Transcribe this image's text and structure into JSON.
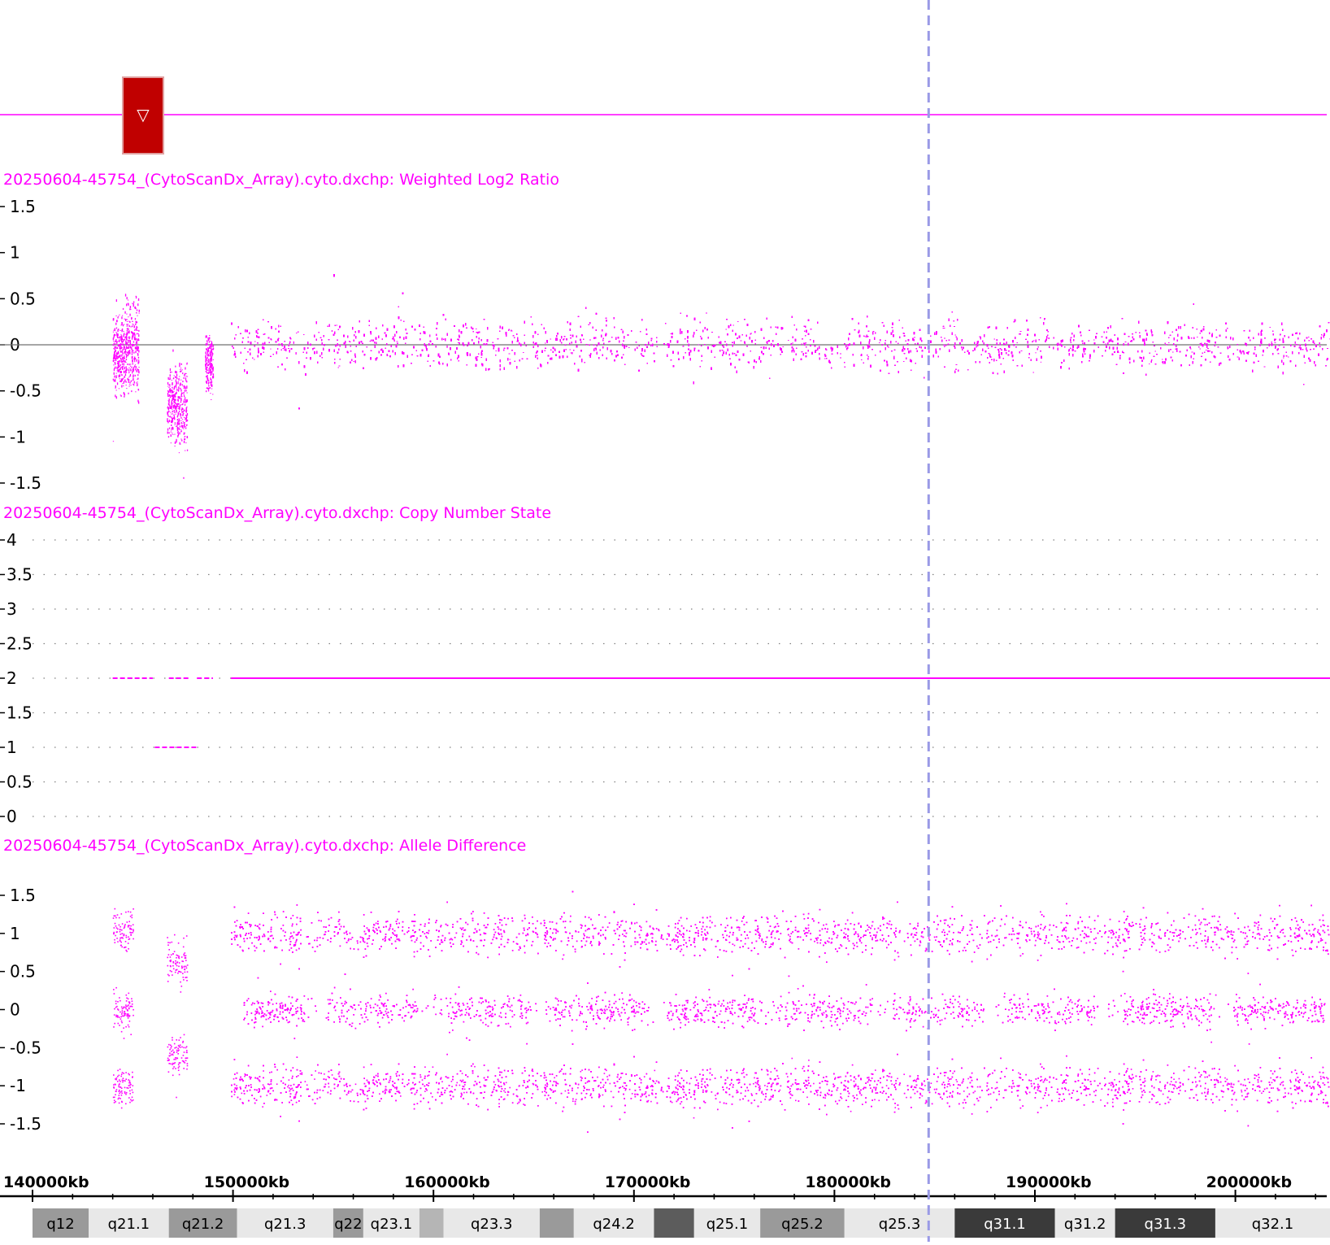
{
  "colors": {
    "data": "#ff00ff",
    "cursor": "#9a9ae6",
    "marker": "#c00000",
    "zero_line": "#707070",
    "grid": "#808080"
  },
  "marker": {
    "icon": "triangle-down-icon",
    "glyph": "▽"
  },
  "panels": {
    "log2": {
      "title": "20250604-45754_(CytoScanDx_Array).cyto.dxchp: Weighted Log2 Ratio"
    },
    "cn": {
      "title": "20250604-45754_(CytoScanDx_Array).cyto.dxchp: Copy Number State"
    },
    "ad": {
      "title": "20250604-45754_(CytoScanDx_Array).cyto.dxchp: Allele Difference"
    }
  },
  "chart_data": [
    {
      "type": "scatter",
      "title": "20250604-45754_(CytoScanDx_Array).cyto.dxchp: Weighted Log2 Ratio",
      "y_ticks": [
        "1.5",
        "1",
        "0.5",
        "0",
        "-0.5",
        "-1",
        "-1.5"
      ],
      "ylim": [
        -1.5,
        1.5
      ],
      "zero_line": true,
      "xlim_kb": [
        140000,
        206000
      ],
      "segments": [
        {
          "x_start": 144000,
          "x_end": 144600,
          "y_mean": -0.1,
          "spread": 0.2
        },
        {
          "x_start": 144600,
          "x_end": 145300,
          "y_mean": -0.05,
          "spread": 0.25
        },
        {
          "x_start": 146700,
          "x_end": 147700,
          "y_mean": -0.65,
          "spread": 0.2
        },
        {
          "x_start": 148600,
          "x_end": 149000,
          "y_mean": -0.2,
          "spread": 0.15
        },
        {
          "x_start": 149900,
          "x_end": 206000,
          "y_mean": 0.0,
          "spread": 0.13
        }
      ]
    },
    {
      "type": "line",
      "title": "20250604-45754_(CytoScanDx_Array).cyto.dxchp: Copy Number State",
      "y_ticks": [
        "4",
        "3.5",
        "3",
        "2.5",
        "2",
        "1.5",
        "1",
        "0.5",
        "0"
      ],
      "ylim": [
        0,
        4
      ],
      "grid": true,
      "xlim_kb": [
        140000,
        206000
      ],
      "segments": [
        {
          "x_start": 144000,
          "x_end": 146000,
          "value": 2
        },
        {
          "x_start": 146800,
          "x_end": 147800,
          "value": 2
        },
        {
          "x_start": 148200,
          "x_end": 149000,
          "value": 2
        },
        {
          "x_start": 146100,
          "x_end": 148200,
          "value": 1
        },
        {
          "x_start": 149900,
          "x_end": 206000,
          "value": 2
        }
      ]
    },
    {
      "type": "scatter",
      "title": "20250604-45754_(CytoScanDx_Array).cyto.dxchp: Allele Difference",
      "y_ticks": [
        "1.5",
        "1",
        "0.5",
        "0",
        "-0.5",
        "-1",
        "-1.5"
      ],
      "ylim": [
        -1.5,
        1.5
      ],
      "xlim_kb": [
        140000,
        206000
      ],
      "bands": [
        {
          "x_start": 149900,
          "x_end": 206000,
          "y": 1.0
        },
        {
          "x_start": 150500,
          "x_end": 206000,
          "y": 0.0
        },
        {
          "x_start": 149900,
          "x_end": 206000,
          "y": -1.0
        },
        {
          "x_start": 146700,
          "x_end": 147700,
          "y": 0.6
        },
        {
          "x_start": 146700,
          "x_end": 147700,
          "y": -0.6
        },
        {
          "x_start": 144000,
          "x_end": 145000,
          "y": 1.05
        },
        {
          "x_start": 144000,
          "x_end": 145000,
          "y": -1.0
        },
        {
          "x_start": 144000,
          "x_end": 145000,
          "y": 0.0
        }
      ]
    }
  ],
  "x_axis": {
    "ticks": [
      {
        "kb": 140000,
        "label": "140000kb"
      },
      {
        "kb": 150000,
        "label": "150000kb"
      },
      {
        "kb": 160000,
        "label": "160000kb"
      },
      {
        "kb": 170000,
        "label": "170000kb"
      },
      {
        "kb": 180000,
        "label": "180000kb"
      },
      {
        "kb": 190000,
        "label": "190000kb"
      },
      {
        "kb": 200000,
        "label": "200000kb"
      }
    ]
  },
  "cursor_kb": 184700,
  "cytobands": [
    {
      "label": "q12",
      "start": 140000,
      "end": 142800,
      "shade": "#9a9a9a"
    },
    {
      "label": "q21.1",
      "start": 142800,
      "end": 146800,
      "shade": "#e8e8e8"
    },
    {
      "label": "q21.2",
      "start": 146800,
      "end": 150200,
      "shade": "#9a9a9a"
    },
    {
      "label": "q21.3",
      "start": 150200,
      "end": 155000,
      "shade": "#e8e8e8"
    },
    {
      "label": "q22",
      "start": 155000,
      "end": 156500,
      "shade": "#9a9a9a"
    },
    {
      "label": "q23.1",
      "start": 156500,
      "end": 159300,
      "shade": "#e8e8e8"
    },
    {
      "label": "",
      "start": 159300,
      "end": 160500,
      "shade": "#b5b5b5"
    },
    {
      "label": "q23.3",
      "start": 160500,
      "end": 165300,
      "shade": "#e8e8e8"
    },
    {
      "label": "",
      "start": 165300,
      "end": 167000,
      "shade": "#9a9a9a"
    },
    {
      "label": "q24.2",
      "start": 167000,
      "end": 171000,
      "shade": "#e8e8e8"
    },
    {
      "label": "",
      "start": 171000,
      "end": 173000,
      "shade": "#5c5c5c"
    },
    {
      "label": "q25.1",
      "start": 173000,
      "end": 176300,
      "shade": "#e8e8e8"
    },
    {
      "label": "q25.2",
      "start": 176300,
      "end": 180500,
      "shade": "#9a9a9a"
    },
    {
      "label": "q25.3",
      "start": 180500,
      "end": 186000,
      "shade": "#e8e8e8"
    },
    {
      "label": "q31.1",
      "start": 186000,
      "end": 191000,
      "shade": "#3a3a3a"
    },
    {
      "label": "q31.2",
      "start": 191000,
      "end": 194000,
      "shade": "#e8e8e8"
    },
    {
      "label": "q31.3",
      "start": 194000,
      "end": 199000,
      "shade": "#3a3a3a"
    },
    {
      "label": "q32.1",
      "start": 199000,
      "end": 206000,
      "shade": "#e8e8e8"
    }
  ]
}
